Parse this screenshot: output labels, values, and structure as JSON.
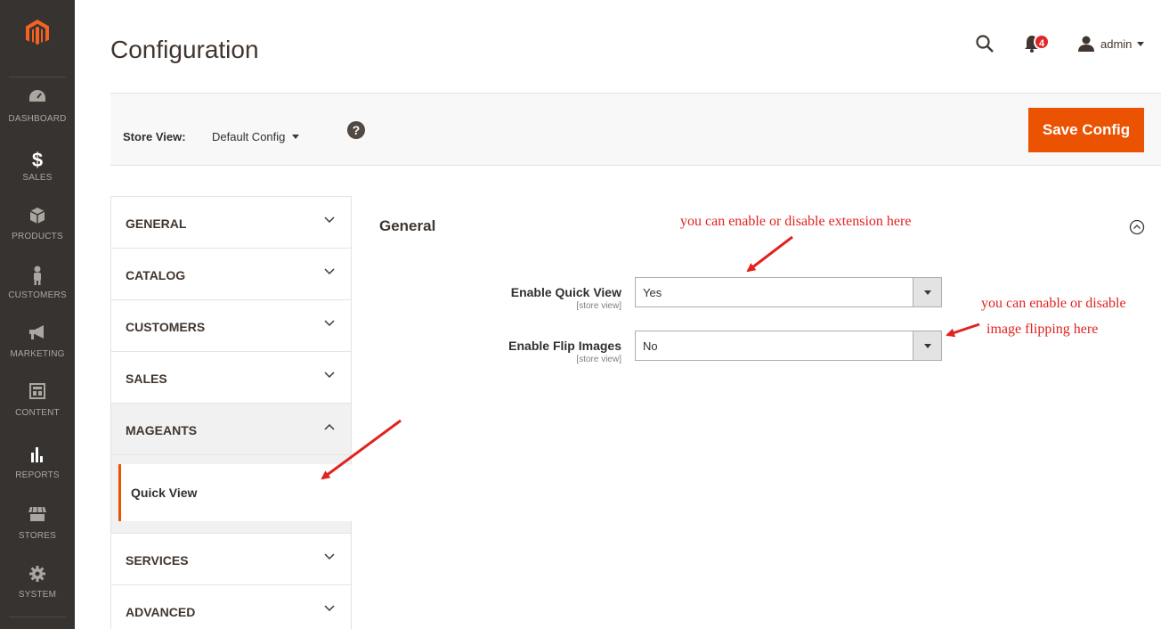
{
  "nav": {
    "items": [
      {
        "label": "DASHBOARD",
        "icon": "dashboard-gauge-icon"
      },
      {
        "label": "SALES",
        "icon": "dollar-icon"
      },
      {
        "label": "PRODUCTS",
        "icon": "cube-icon"
      },
      {
        "label": "CUSTOMERS",
        "icon": "person-icon"
      },
      {
        "label": "MARKETING",
        "icon": "megaphone-icon"
      },
      {
        "label": "CONTENT",
        "icon": "layout-icon"
      },
      {
        "label": "REPORTS",
        "icon": "bar-chart-icon"
      },
      {
        "label": "STORES",
        "icon": "storefront-icon"
      },
      {
        "label": "SYSTEM",
        "icon": "gear-icon"
      }
    ]
  },
  "header": {
    "title": "Configuration",
    "notification_count": "4",
    "user_name": "admin"
  },
  "store_bar": {
    "label": "Store View:",
    "selected": "Default Config",
    "help": "?",
    "save_label": "Save Config"
  },
  "tabs": [
    {
      "label": "GENERAL"
    },
    {
      "label": "CATALOG"
    },
    {
      "label": "CUSTOMERS"
    },
    {
      "label": "SALES"
    },
    {
      "label": "MAGEANTS",
      "sub": "Quick View"
    },
    {
      "label": "SERVICES"
    },
    {
      "label": "ADVANCED"
    }
  ],
  "section": {
    "title": "General",
    "fields": [
      {
        "label": "Enable Quick View",
        "scope": "[store view]",
        "value": "Yes"
      },
      {
        "label": "Enable Flip Images",
        "scope": "[store view]",
        "value": "No"
      }
    ]
  },
  "annotations": {
    "top": "you can enable or disable extension here",
    "right_line1": "you can enable or disable",
    "right_line2": "image flipping here"
  },
  "colors": {
    "accent": "#eb5202",
    "nav_bg": "#373330",
    "annotation": "#e0231f"
  }
}
